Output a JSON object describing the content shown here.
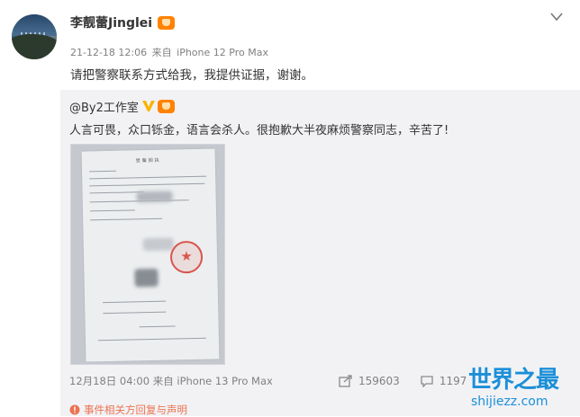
{
  "post": {
    "author": "李靓蕾Jinglei",
    "badge_icon": "vip-crown-icon",
    "timestamp": "21-12-18 12:06",
    "source_prefix": "来自",
    "device": "iPhone 12 Pro Max",
    "text": "请把警察联系方式给我，我提供证据，谢谢。"
  },
  "repost": {
    "author": "@By2工作室",
    "text": "人言可畏，众口铄金，语言会杀人。很抱歉大半夜麻烦警察同志，辛苦了!",
    "document_title": "受案回执",
    "footer": "12月18日 04:00 来自 iPhone 13 Pro Max",
    "reposts": "159603",
    "comments": "1197",
    "next_line": "事件相关方回复与声明"
  },
  "watermark": {
    "title": "世界之最",
    "url": "shijiezz.com"
  },
  "colors": {
    "link": "#eb7350",
    "watermark": "#1b8fd8",
    "vip_badge": "#ff8200",
    "verified": "#f7b500"
  }
}
